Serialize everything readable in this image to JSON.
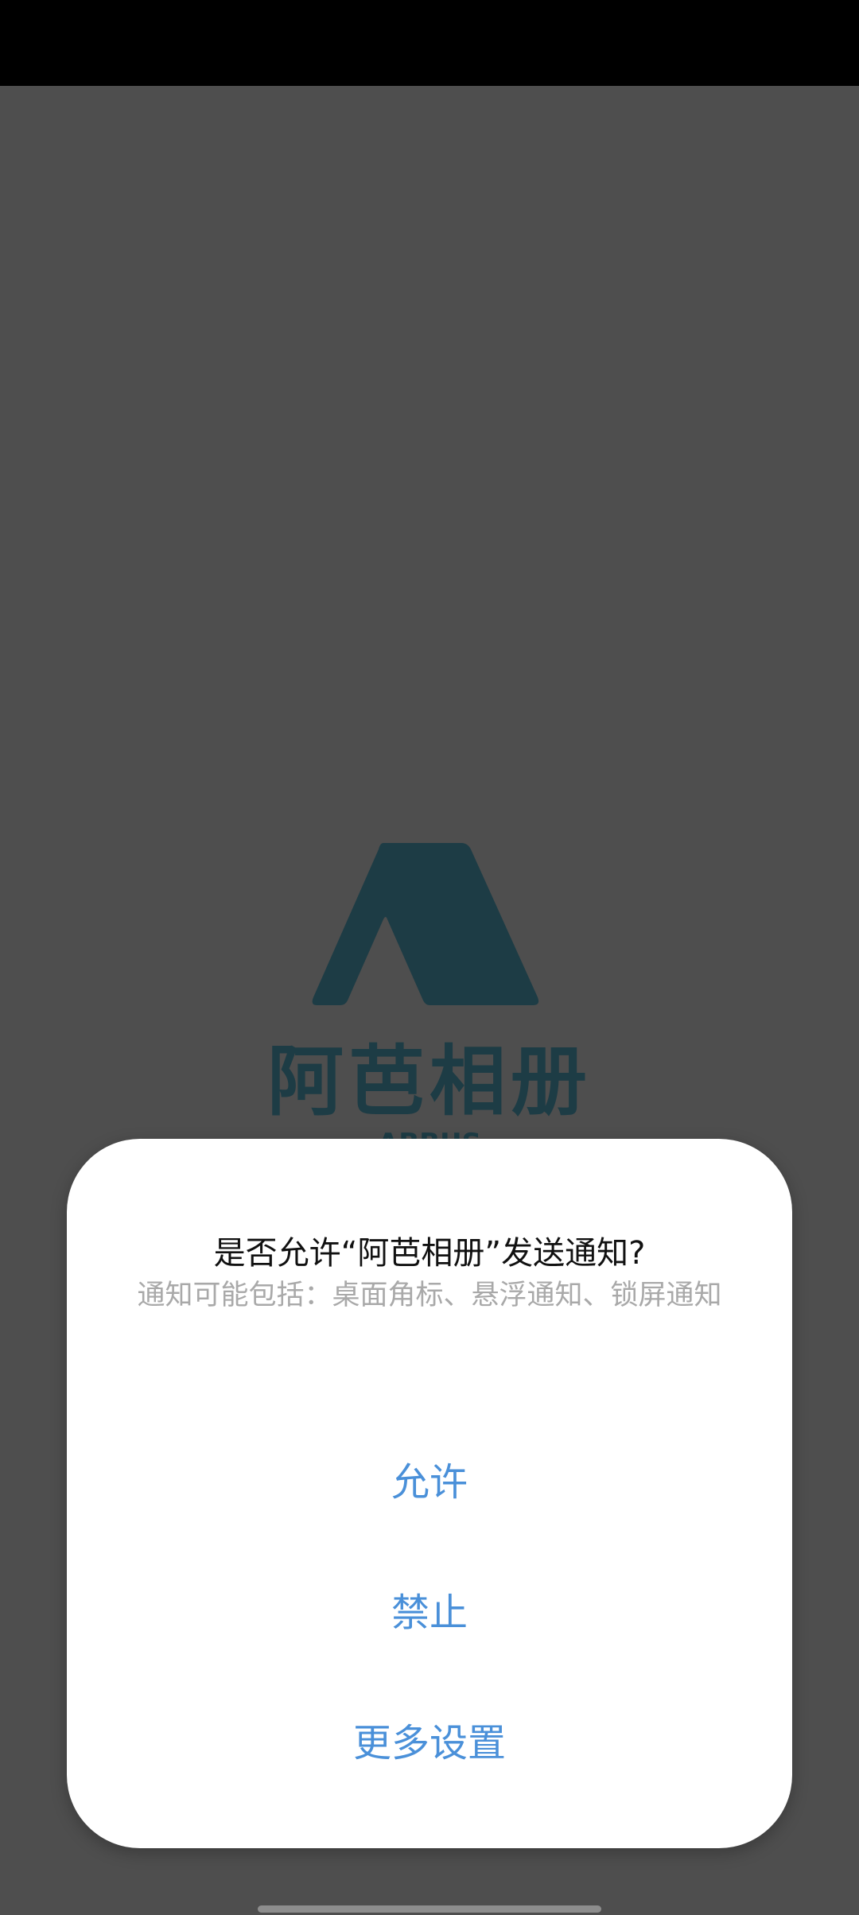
{
  "app": {
    "name": "阿芭相册",
    "subtitle": "ABBUS"
  },
  "dialog": {
    "title": "是否允许“阿芭相册”发送通知?",
    "message": "通知可能包括：桌面角标、悬浮通知、锁屏通知",
    "buttons": {
      "allow": "允许",
      "deny": "禁止",
      "more": "更多设置"
    }
  },
  "icons": {
    "logo": "tent-logo-icon",
    "navigation": "gesture-handle"
  },
  "colors": {
    "logo": "#1d3c45",
    "dialog_button": "#4a90d9",
    "overlay": "#4e4e4e"
  }
}
